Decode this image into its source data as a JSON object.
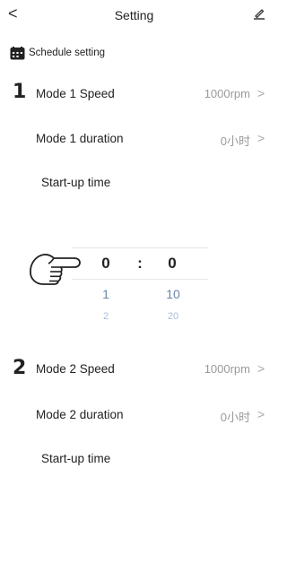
{
  "header": {
    "title": "Setting",
    "back_icon": "chevron-left-icon",
    "edit_icon": "pen-icon"
  },
  "section": {
    "label": "Schedule setting",
    "icon": "calendar-icon"
  },
  "mode1": {
    "step": "1",
    "speed_label": "Mode 1 Speed",
    "speed_value": "1000rpm",
    "duration_label": "Mode 1 duration",
    "duration_value": "0小时",
    "startup_label": "Start-up time"
  },
  "picker": {
    "hours_selected": "0",
    "separator": ":",
    "minutes_selected": "0",
    "hours_next": "1",
    "minutes_next": "10",
    "hours_next2": "2",
    "minutes_next2": "20",
    "hand_icon": "pointing-hand-icon"
  },
  "mode2": {
    "step": "2",
    "speed_label": "Mode 2 Speed",
    "speed_value": "1000rpm",
    "duration_label": "Mode 2 duration",
    "duration_value": "0小时",
    "startup_label": "Start-up time"
  },
  "chevron_glyph": ">"
}
